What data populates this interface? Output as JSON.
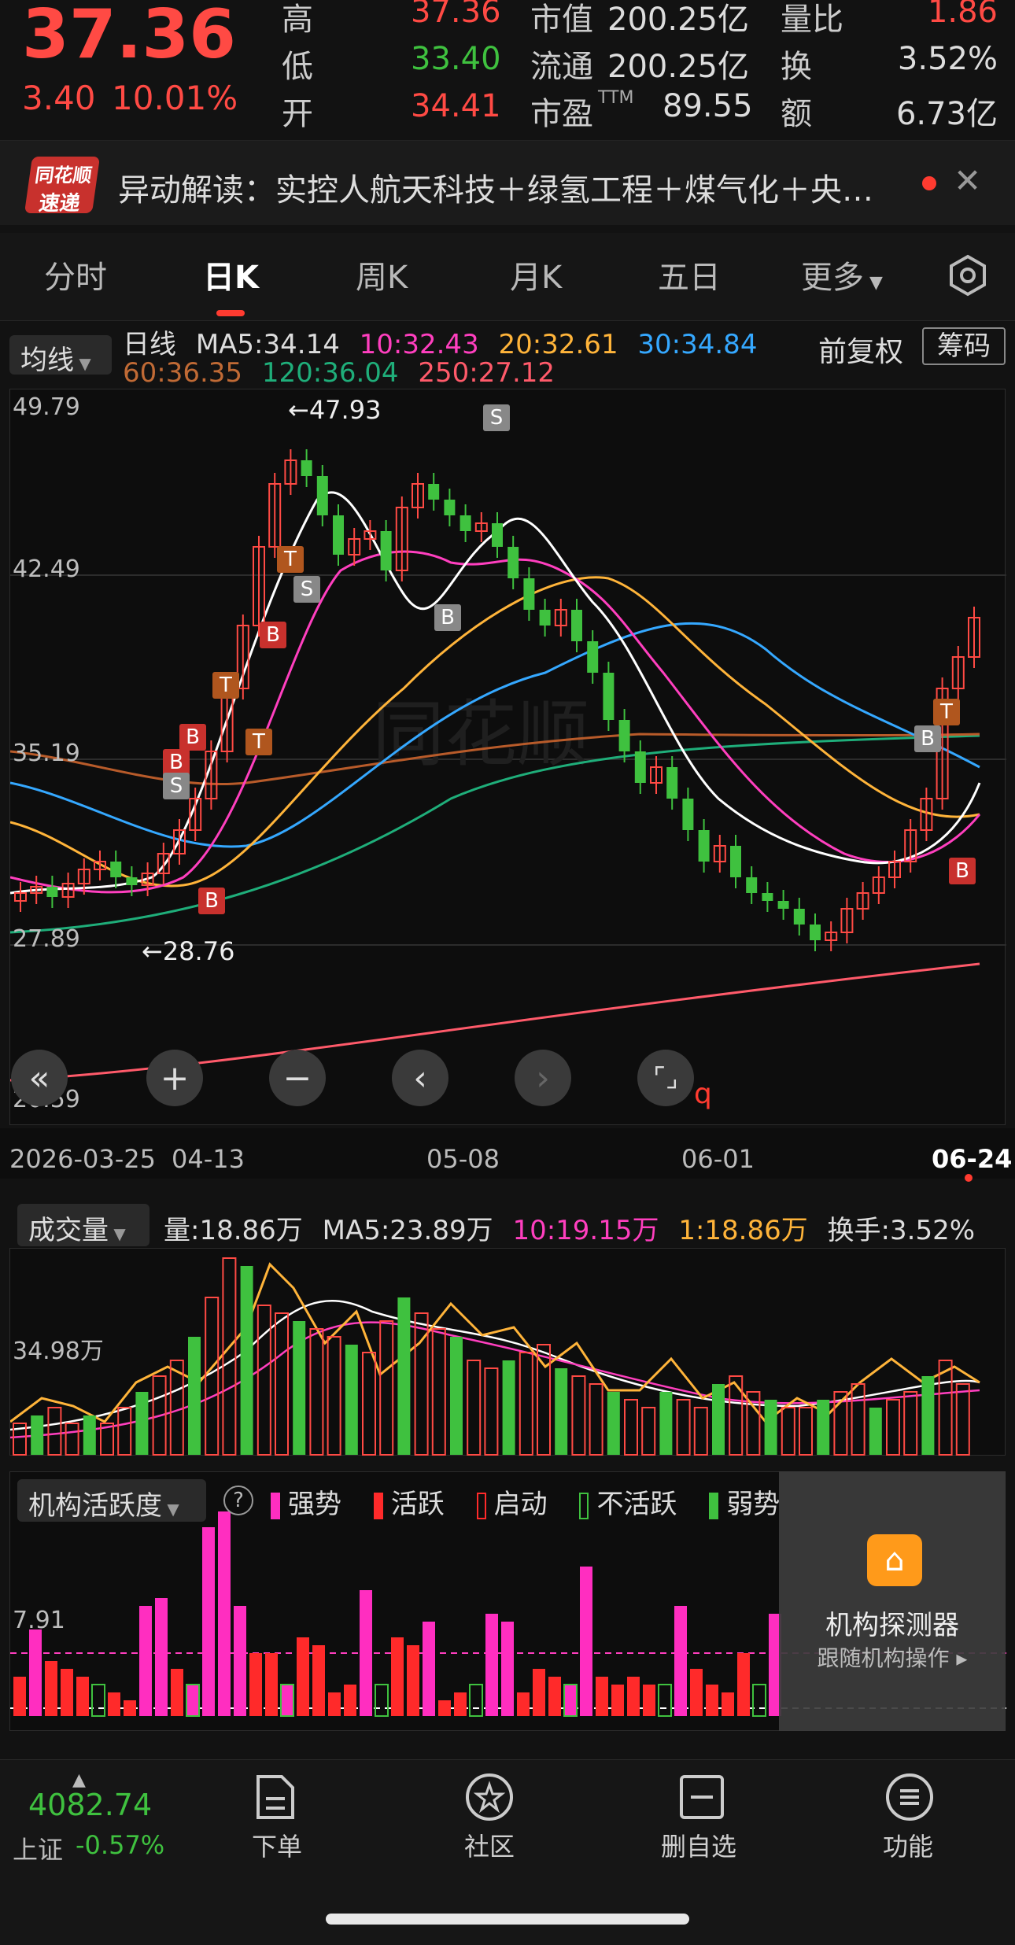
{
  "quote": {
    "price": "37.36",
    "change": "3.40",
    "pct": "10.01%"
  },
  "stats": {
    "high_label": "高",
    "high": "37.36",
    "low_label": "低",
    "low": "33.40",
    "open_label": "开",
    "open": "34.41",
    "mcap_label": "市值",
    "mcap": "200.25亿",
    "float_label": "流通",
    "float": "200.25亿",
    "pe_label": "市盈",
    "pe_sup": "TTM",
    "pe": "89.55",
    "vr_label": "量比",
    "vr": "1.86",
    "turn_label": "换",
    "turn": "3.52%",
    "amt_label": "额",
    "amt": "6.73亿"
  },
  "news": {
    "badge_top": "同花顺",
    "badge_bottom": "速递",
    "text": "异动解读：实控人航天科技＋绿氢工程＋煤气化＋央…"
  },
  "tabs": [
    "分时",
    "日K",
    "周K",
    "月K",
    "五日",
    "更多"
  ],
  "ma": {
    "selector": "均线",
    "line1": [
      "日线",
      "MA5:34.14",
      "10:32.43",
      "20:32.61",
      "30:34.84"
    ],
    "line2": [
      "60:36.35",
      "120:36.04",
      "250:27.12"
    ],
    "adjust": "前复权",
    "chips": "筹码"
  },
  "kline": {
    "ylabels": [
      "49.79",
      "42.49",
      "35.19",
      "27.89",
      "20.59"
    ],
    "hi": "←47.93",
    "lo": "←28.76",
    "watermark": "同花顺",
    "dates": [
      "2026-03-25",
      "04-13",
      "05-08",
      "06-01",
      "06-24"
    ],
    "q": "q"
  },
  "markers": {
    "b": "B",
    "s": "S",
    "t": "T"
  },
  "vol": {
    "selector": "成交量",
    "items": [
      "量:18.86万",
      "MA5:23.89万",
      "10:19.15万",
      "1:18.86万",
      "换手:3.52%"
    ],
    "ylabel": "34.98万"
  },
  "inst": {
    "selector": "机构活跃度",
    "help": "?",
    "legend": [
      "强势",
      "活跃",
      "启动",
      "不活跃",
      "弱势"
    ],
    "ylabel": "7.91",
    "panel_title": "机构探测器",
    "panel_sub": "跟随机构操作 ▸"
  },
  "bottom": {
    "index_val": "4082.74",
    "index_name": "上证",
    "index_pct": "-0.57%",
    "btn1": "下单",
    "btn2": "社区",
    "btn3": "删自选",
    "btn4": "功能"
  },
  "colors": {
    "up": "#ff4a44",
    "down": "#3fc13f",
    "ma5": "#ffffff",
    "ma10": "#ff3fbf",
    "ma20": "#ffb43a",
    "ma30": "#35a8ff",
    "ma60": "#b85b2a",
    "ma120": "#1fae7a",
    "ma250": "#ff5a6a"
  }
}
